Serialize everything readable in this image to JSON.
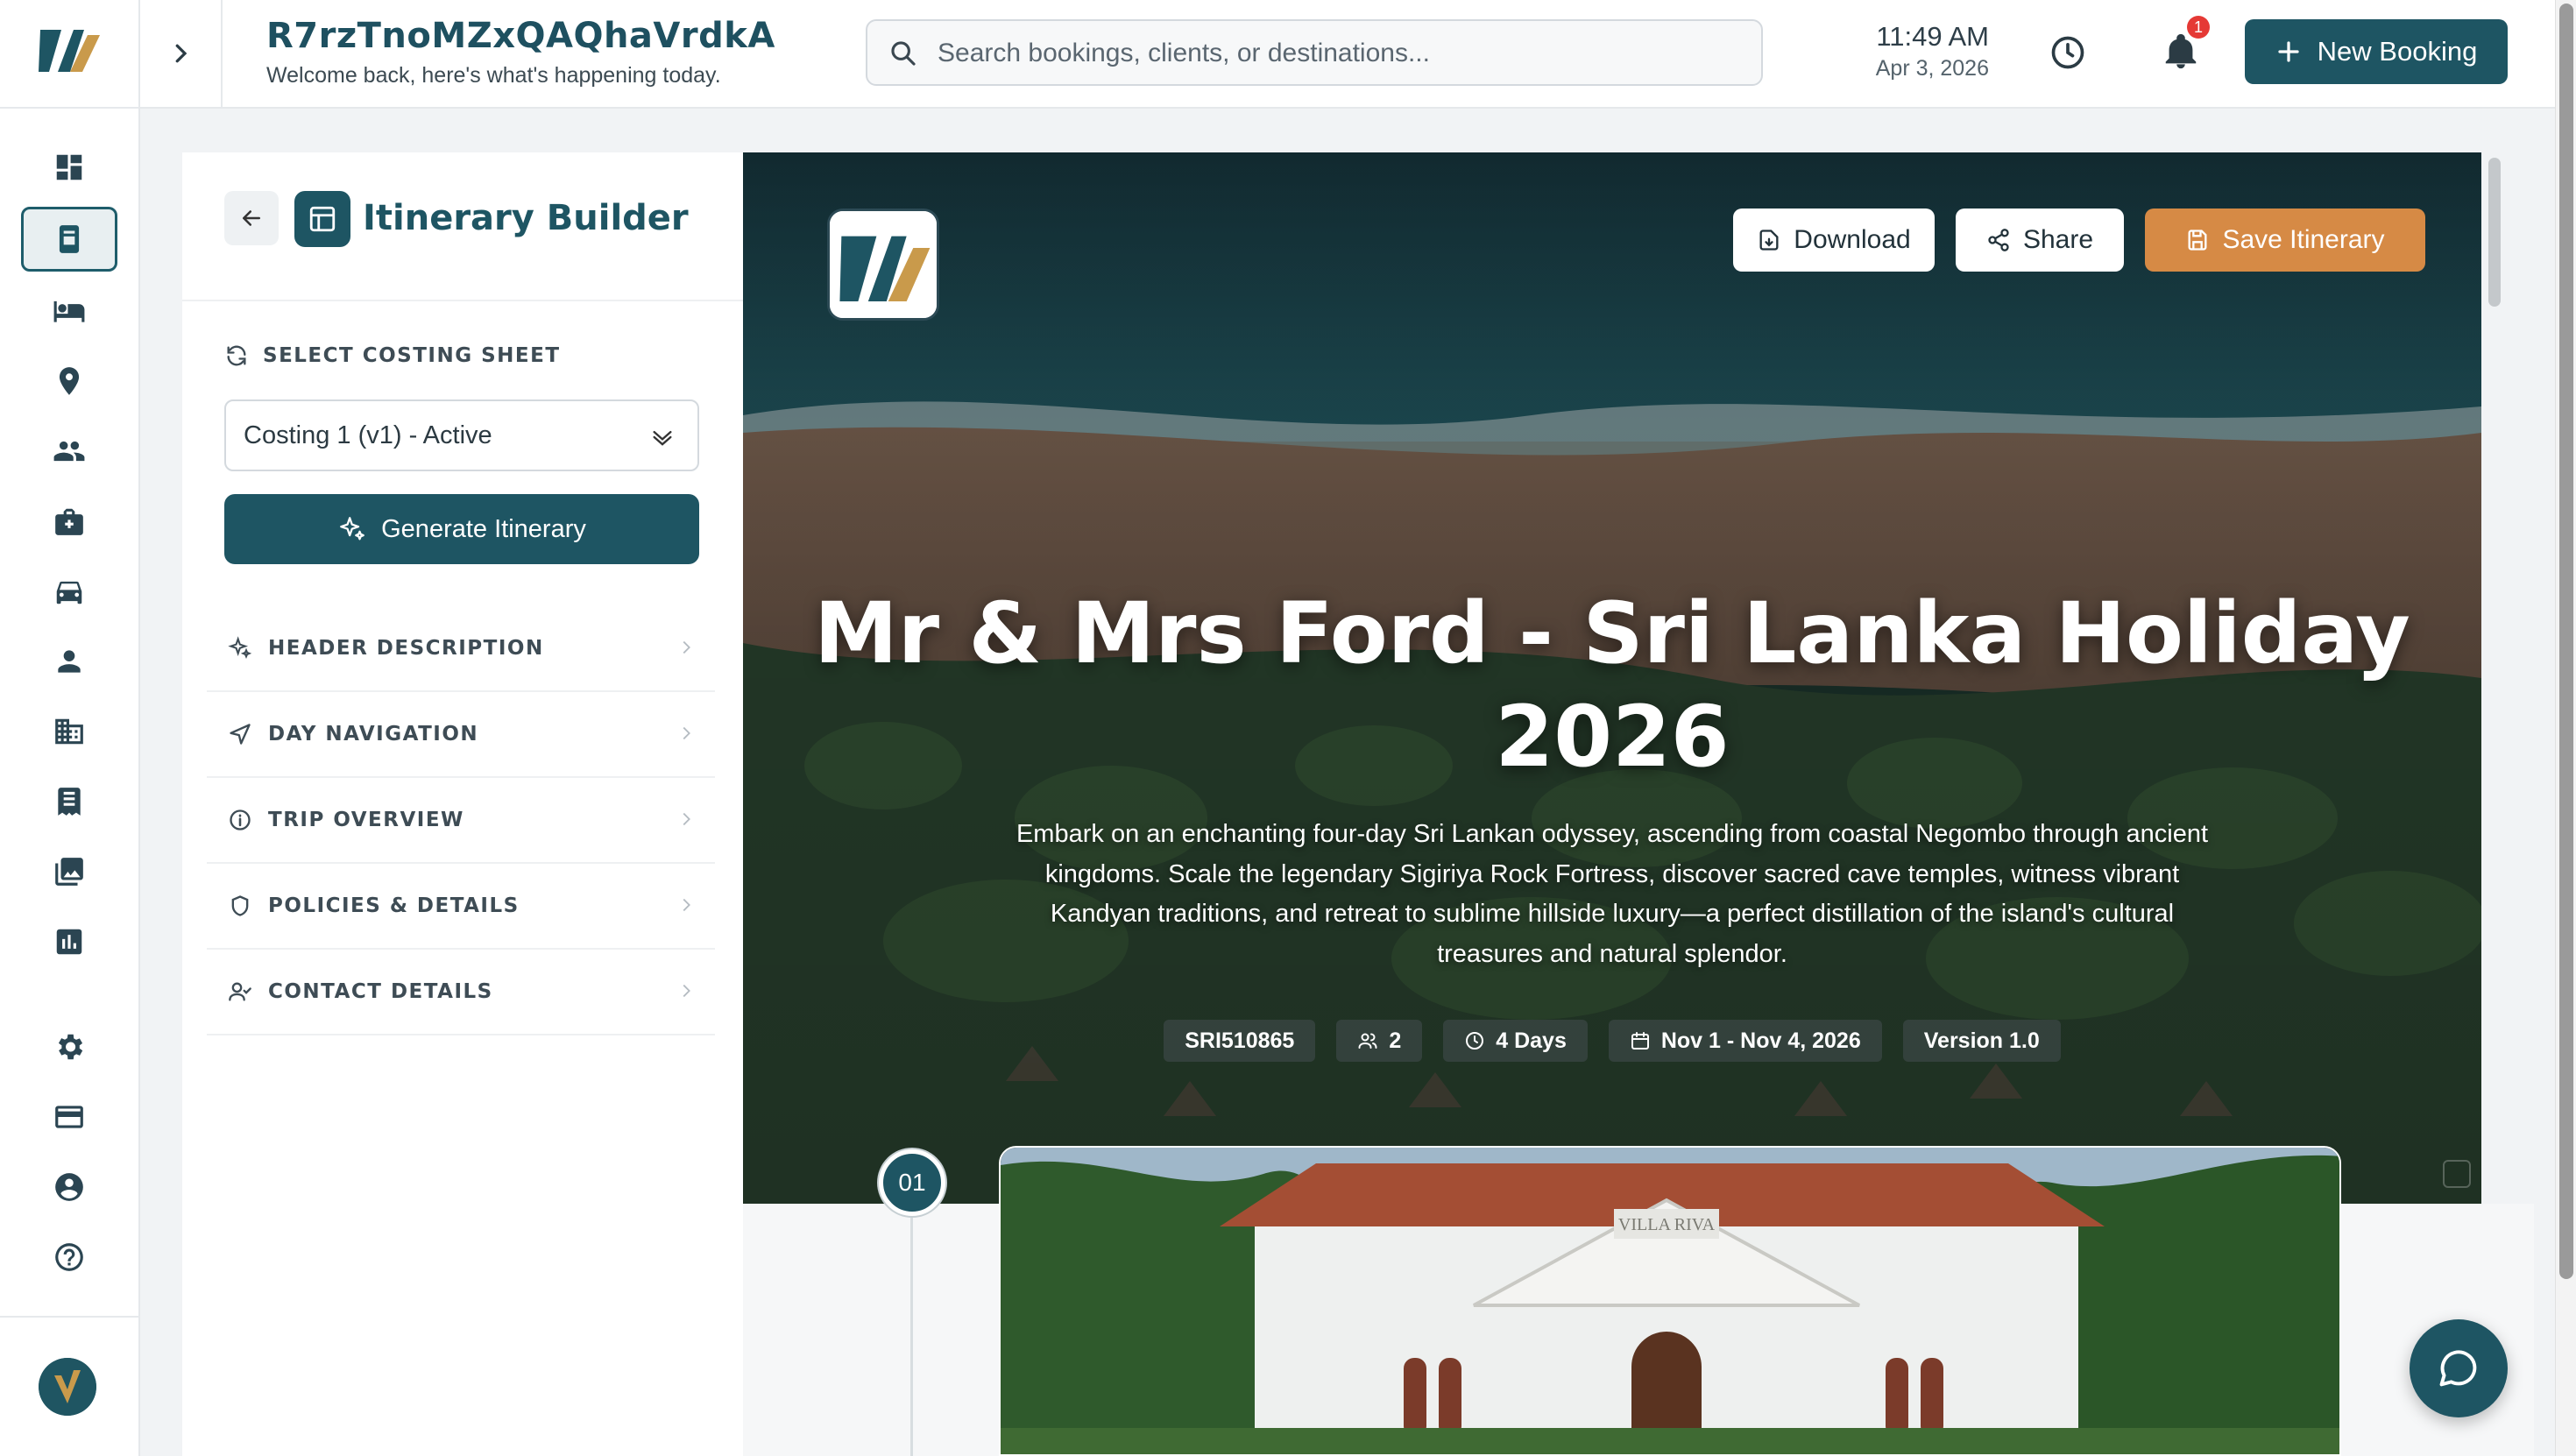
{
  "header": {
    "title": "R7rzTnoMZxQAQhaVrdkA",
    "subtitle": "Welcome back, here's what's happening today.",
    "search_placeholder": "Search bookings, clients, or destinations...",
    "time": "11:49 AM",
    "date": "Apr 3, 2026",
    "notification_count": "1",
    "new_booking_label": "New Booking"
  },
  "sidebar_icons": [
    "dashboard-icon",
    "itinerary-icon",
    "hotel-icon",
    "location-icon",
    "clients-icon",
    "suppliers-icon",
    "vehicle-icon",
    "user-icon",
    "buildings-icon",
    "invoice-icon",
    "gallery-icon",
    "reports-icon",
    "settings-icon",
    "billing-icon",
    "account-icon",
    "help-icon"
  ],
  "builder": {
    "title": "Itinerary Builder",
    "costing_label": "SELECT COSTING SHEET",
    "costing_value": "Costing 1 (v1) - Active",
    "generate_label": "Generate Itinerary",
    "nav": [
      "HEADER DESCRIPTION",
      "DAY NAVIGATION",
      "TRIP OVERVIEW",
      "POLICIES & DETAILS",
      "CONTACT DETAILS"
    ]
  },
  "hero": {
    "download_label": "Download",
    "share_label": "Share",
    "save_label": "Save Itinerary",
    "title": "Mr & Mrs Ford - Sri Lanka Holiday 2026",
    "description": "Embark on an enchanting four-day Sri Lankan odyssey, ascending from coastal Negombo through ancient kingdoms. Scale the legendary Sigiriya Rock Fortress, discover sacred cave temples, witness vibrant Kandyan traditions, and retreat to sublime hillside luxury—a perfect distillation of the island's cultural treasures and natural splendor.",
    "chips": {
      "ref": "SRI510865",
      "pax": "2",
      "duration": "4 Days",
      "dates": "Nov 1 - Nov 4, 2026",
      "version": "Version 1.0"
    }
  },
  "day": {
    "number": "01",
    "sign_text": "VILLA RIVA"
  },
  "colors": {
    "primary": "#1e5563",
    "accent": "#d68a45",
    "badge": "#e53935"
  }
}
